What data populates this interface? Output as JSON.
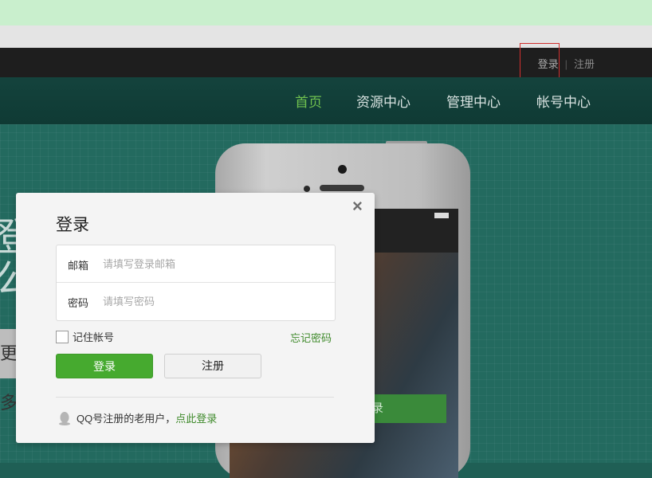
{
  "topbar": {
    "login": "登录",
    "separator": "|",
    "register": "注册"
  },
  "nav": {
    "items": [
      "首页",
      "资源中心",
      "管理中心",
      "帐号中心"
    ],
    "active_index": 0
  },
  "hero": {
    "text_line1": "登",
    "text_line2": "公",
    "button_text": "更多"
  },
  "phone": {
    "screen_button": "录"
  },
  "modal": {
    "close_icon": "×",
    "title": "登录",
    "email_label": "邮箱",
    "email_placeholder": "请填写登录邮箱",
    "password_label": "密码",
    "password_placeholder": "请填写密码",
    "remember_label": "记住帐号",
    "forgot_link": "忘记密码",
    "login_button": "登录",
    "register_button": "注册",
    "qq_text": "QQ号注册的老用户，",
    "qq_link": "点此登录"
  },
  "colors": {
    "accent": "#46aa2f",
    "link": "#3f8a2b",
    "nav_active": "#6fc14f"
  }
}
